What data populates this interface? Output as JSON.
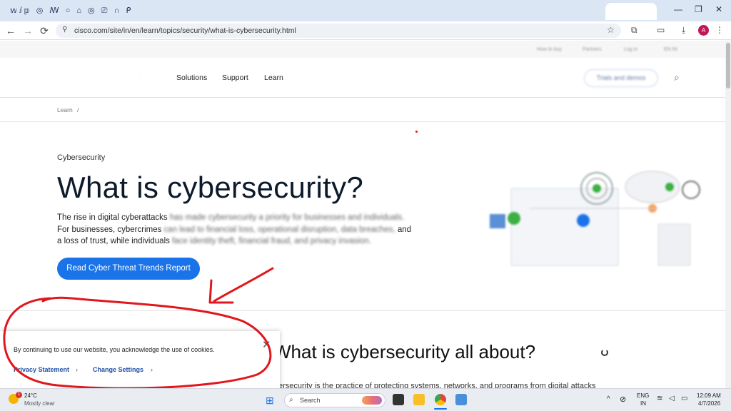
{
  "browser": {
    "tab_strip_text": "𝕨ⅈ𝕡 ◎ ꟿ ○ ⌂ ◎ ⎚ ∩ ᑭ",
    "url": "cisco.com/site/in/en/learn/topics/security/what-is-cybersecurity.html",
    "back_icon": "←",
    "forward_icon": "→",
    "reload_icon": "⟳",
    "star_icon": "☆",
    "profile_initial": "A",
    "minimize_icon": "—",
    "restore_icon": "❐",
    "close_icon": "✕"
  },
  "utility_nav": {
    "items": [
      "How to buy",
      "Partners",
      "Log in",
      "EN IN"
    ]
  },
  "main_nav": {
    "links": [
      "Solutions",
      "Support",
      "Learn"
    ],
    "trials_label": "Trials and demos",
    "search_icon": "⌕"
  },
  "breadcrumb": {
    "items": [
      "Learn",
      "/"
    ]
  },
  "hero": {
    "eyebrow": "Cybersecurity",
    "title": "What is cybersecurity?",
    "desc_line1_clear": "The rise in digital cyberattacks ",
    "desc_line1_blur": "has made cybersecurity a priority for businesses and individuals.",
    "desc_line2_clear": "For businesses, cybercrimes ",
    "desc_line2_blur": "can lead to financial loss, operational disruption, data breaches,",
    "desc_line2_tail": " and",
    "desc_line3_clear": "a loss of trust, while individuals ",
    "desc_line3_blur": "face identity theft, financial fraud, and privacy invasion.",
    "cta_label": "Read Cyber Threat Trends Report"
  },
  "section2": {
    "title": "What is cybersecurity all about?",
    "body": "ersecurity is the practice of protecting systems, networks, and programs from digital attacks"
  },
  "cookie_banner": {
    "text": "By continuing to use our website, you acknowledge the use of cookies.",
    "privacy_link": "Privacy Statement",
    "settings_link": "Change Settings",
    "chevron": "›",
    "close_icon": "✕"
  },
  "taskbar": {
    "weather_temp": "24°C",
    "weather_desc": "Mostly clear",
    "search_placeholder": "Search",
    "lang_line1": "ENG",
    "lang_line2": "IN",
    "time": "12:09 AM",
    "date": "4/7/2026",
    "notification_count": "1",
    "chevron_up": "^"
  },
  "colors": {
    "accent": "#1a73e8",
    "annotation": "#e0171c",
    "title": "#0d1a2b"
  }
}
